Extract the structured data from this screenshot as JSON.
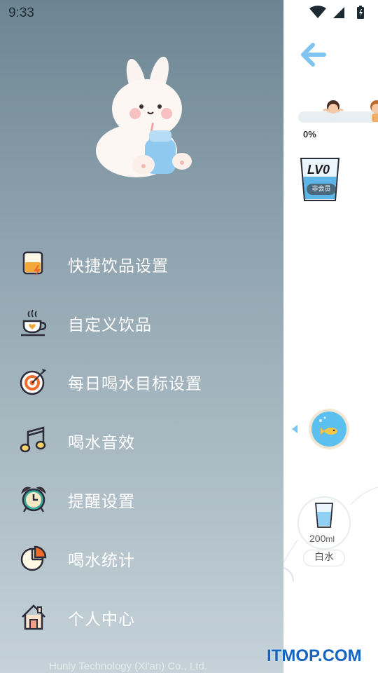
{
  "status_bar": {
    "time": "9:33"
  },
  "menu": {
    "items": [
      {
        "label": "快捷饮品设置",
        "icon": "quick-drink-icon"
      },
      {
        "label": "自定义饮品",
        "icon": "teacup-icon"
      },
      {
        "label": "每日喝水目标设置",
        "icon": "target-icon"
      },
      {
        "label": "喝水音效",
        "icon": "music-note-icon"
      },
      {
        "label": "提醒设置",
        "icon": "alarm-clock-icon"
      },
      {
        "label": "喝水统计",
        "icon": "pie-chart-icon"
      },
      {
        "label": "个人中心",
        "icon": "home-icon"
      }
    ]
  },
  "footer": {
    "company": "Hunly Technology (Xi'an) Co., Ltd."
  },
  "main": {
    "progress_percent": "0%",
    "progress_value": 0,
    "level": "LV0",
    "member_badge": "非会员",
    "quick_drink": {
      "amount": "200",
      "unit": "ml",
      "name": "白水"
    }
  },
  "watermark": "ITMOP.COM",
  "colors": {
    "accent_blue": "#5bb5e6",
    "drawer_top": "#6d8593",
    "drawer_bottom": "#c5d2d9",
    "watermark": "#1565c0"
  }
}
